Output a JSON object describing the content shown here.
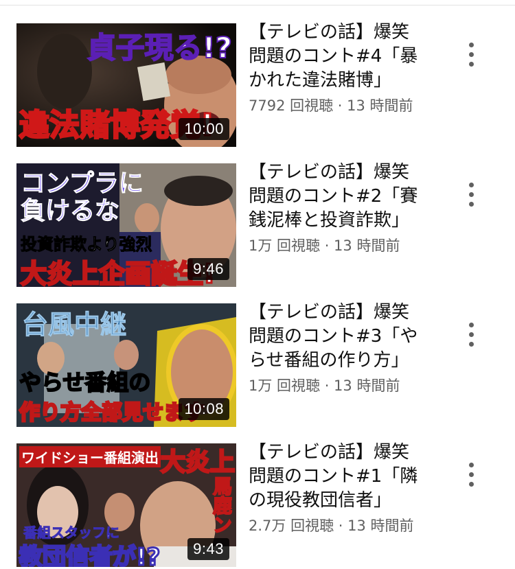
{
  "videos": [
    {
      "title": "【テレビの話】爆笑問題のコント#4「暴かれた違法賭博」",
      "title_lines": [
        "【テレビの話】爆笑",
        "問題のコント#4「暴",
        "かれた違法賭博」"
      ],
      "meta": "7792 回視聴 · 13 時間前",
      "duration": "10:00",
      "thumb_text": [
        "貞子現る!?",
        "違法賭博発覚!"
      ]
    },
    {
      "title": "【テレビの話】爆笑問題のコント#2「賽銭泥棒と投資詐欺」",
      "title_lines": [
        "【テレビの話】爆笑",
        "問題のコント#2「賽",
        "銭泥棒と投資詐欺」"
      ],
      "meta": "1万 回視聴 · 13 時間前",
      "duration": "9:46",
      "thumb_text": [
        "コンプラに",
        "負けるな",
        "投資詐欺より強烈",
        "大炎上企画誕生!"
      ]
    },
    {
      "title": "【テレビの話】爆笑問題のコント#3「やらせ番組の作り方」",
      "title_lines": [
        "【テレビの話】爆笑",
        "問題のコント#3「や",
        "らせ番組の作り方」"
      ],
      "meta": "1万 回視聴 · 13 時間前",
      "duration": "10:08",
      "thumb_text": [
        "台風中継",
        "やらせ番組の",
        "作り方全部見せます"
      ]
    },
    {
      "title": "【テレビの話】爆笑問題のコント#1「隣の現役教団信者」",
      "title_lines": [
        "【テレビの話】爆笑",
        "問題のコント#1「隣",
        "の現役教団信者」"
      ],
      "meta": "2.7万 回視聴 · 13 時間前",
      "duration": "9:43",
      "thumb_text": [
        "ワイドショー番組演出",
        "大炎上",
        "馬鹿ン",
        "番組スタッフに",
        "教団信者が!?"
      ]
    }
  ],
  "colors": {
    "title": "#0f0f0f",
    "meta": "#606060",
    "divider": "#e3e3e3",
    "duration_bg": "#000000"
  },
  "icons": {
    "menu": "more-vertical-icon"
  }
}
